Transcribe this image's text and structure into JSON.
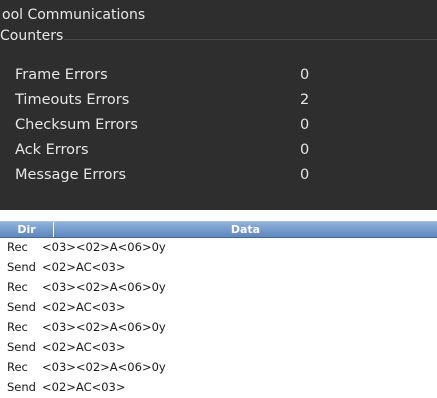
{
  "window": {
    "title": "ool Communications"
  },
  "counters_group": {
    "label": "Counters",
    "items": [
      {
        "name": "Frame Errors",
        "value": "0"
      },
      {
        "name": "Timeouts Errors",
        "value": "2"
      },
      {
        "name": "Checksum Errors",
        "value": "0"
      },
      {
        "name": "Ack Errors",
        "value": "0"
      },
      {
        "name": "Message Errors",
        "value": "0"
      }
    ]
  },
  "log_table": {
    "columns": [
      "Dir",
      "Data"
    ],
    "rows": [
      {
        "dir": "Rec",
        "data": "<03><02>A<06>0y"
      },
      {
        "dir": "Send",
        "data": "<02>AC<03>"
      },
      {
        "dir": "Rec",
        "data": "<03><02>A<06>0y"
      },
      {
        "dir": "Send",
        "data": "<02>AC<03>"
      },
      {
        "dir": "Rec",
        "data": "<03><02>A<06>0y"
      },
      {
        "dir": "Send",
        "data": "<02>AC<03>"
      },
      {
        "dir": "Rec",
        "data": "<03><02>A<06>0y"
      },
      {
        "dir": "Send",
        "data": "<02>AC<03>"
      }
    ]
  }
}
